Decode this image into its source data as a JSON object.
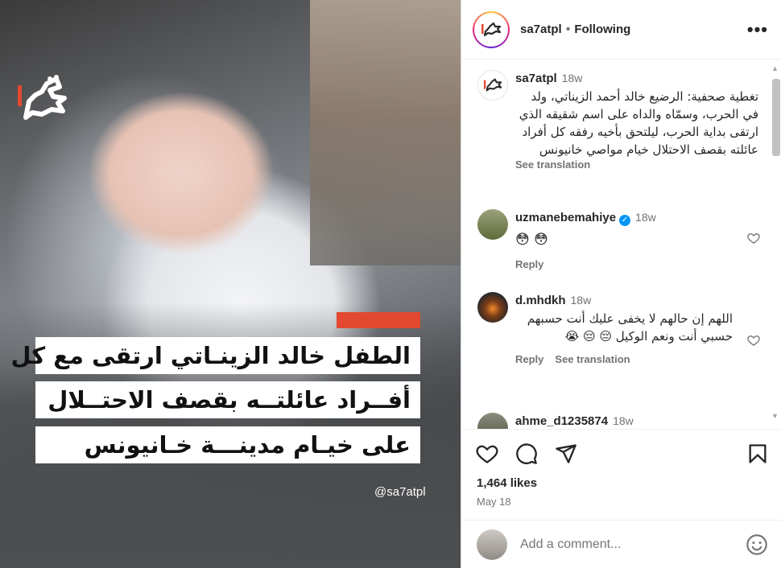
{
  "post_image": {
    "headline_lines": [
      "الطفل خالد الزينـاتي ارتقى مع كل",
      "أفــراد عائلتــه بقصف الاحتــلال",
      "على خيـام مدينـــة خـانيونس"
    ],
    "watermark": "@sa7atpl",
    "accent_color": "#e2492f"
  },
  "header": {
    "username": "sa7atpl",
    "separator": "•",
    "follow_status": "Following",
    "more_icon": "more-horizontal-icon"
  },
  "caption": {
    "username": "sa7atpl",
    "time": "18w",
    "text": "تغطية صحفية: الرضيع خالد أحمد الزيناتي، ولد في الحرب، وسمّاه والداه على اسم شقيقه الذي ارتقى بداية الحرب، ليلتحق بأخيه رفقه كل أفراد عائلته بقصف الاحتلال خيام مواصي خانيونس",
    "see_translation": "See translation"
  },
  "comments": [
    {
      "username": "uzmanebemahiye",
      "verified": true,
      "time": "18w",
      "text": "😳 😳",
      "reply": "Reply"
    },
    {
      "username": "d.mhdkh",
      "time": "18w",
      "text": "اللهم إن حالهم لا يخفى عليك أنت حسبهم حسبي أنت ونعم الوكيل 😔 😔 😭",
      "reply": "Reply",
      "see_translation": "See translation"
    },
    {
      "username": "ahme_d1235874",
      "time": "18w"
    }
  ],
  "actions": {
    "like_icon": "heart-icon",
    "comment_icon": "comment-icon",
    "share_icon": "share-icon",
    "save_icon": "bookmark-icon",
    "likes": "1,464 likes",
    "date": "May 18"
  },
  "add_comment": {
    "placeholder": "Add a comment...",
    "emoji_icon": "emoji-icon"
  },
  "colors": {
    "verified": "#0095f6",
    "border": "#dbdbdb",
    "muted": "#737373"
  }
}
